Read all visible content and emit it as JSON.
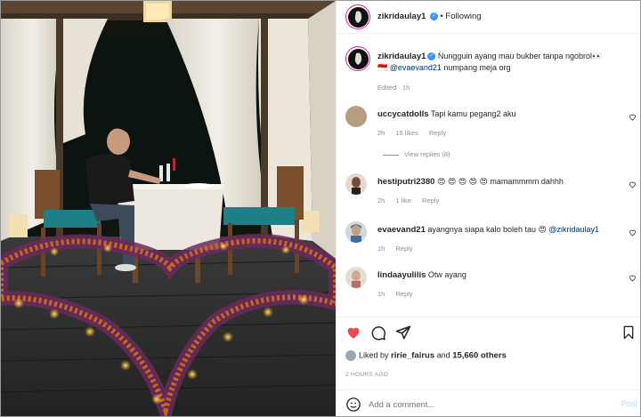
{
  "post": {
    "username": "zikridaulay1",
    "follow_label": "Following",
    "caption_text": "Nungguin ayang mau bukber tanpa ngobrol👀",
    "caption_line2_flag": "🇮🇩",
    "caption_mention": "@evaevand21",
    "caption_line2_rest": " numpang meja org",
    "caption_meta": "Edited · 1h"
  },
  "comments": [
    {
      "user": "uccycatdolls",
      "text": "Tapi kamu pegang2 aku",
      "time": "2h",
      "likes": "16 likes",
      "reply": "Reply",
      "view_replies": "View replies (8)"
    },
    {
      "user": "hestiputri2380",
      "text": "😍 😍 😍 😍 😍 mamammmm dahhh",
      "time": "2h",
      "likes": "1 like",
      "reply": "Reply"
    },
    {
      "user": "evaevand21",
      "text": "ayangnya siapa kalo boleh tau 😍",
      "mention": "@zikridaulay1",
      "time": "1h",
      "reply": "Reply"
    },
    {
      "user": "lindaayulilis",
      "text": "Otw ayang",
      "time": "1h",
      "reply": "Reply"
    }
  ],
  "liked_by": {
    "prefix": "Liked by ",
    "user": "ririe_fairus",
    "middle": " and ",
    "count": "15,660 others"
  },
  "timestamp": "2 HOURS AGO",
  "add_comment": {
    "placeholder": "Add a comment...",
    "post_label": "Post"
  },
  "icons": {
    "like": "heart-icon-filled",
    "comment": "comment-icon",
    "share": "share-icon",
    "save": "bookmark-icon",
    "emoji": "smiley-icon",
    "more": "more-icon"
  },
  "colors": {
    "like_red": "#ed4956",
    "verified_blue": "#3897f0",
    "link": "#00376b",
    "muted": "#8e8e8e",
    "post_disabled": "#b3dbff"
  }
}
